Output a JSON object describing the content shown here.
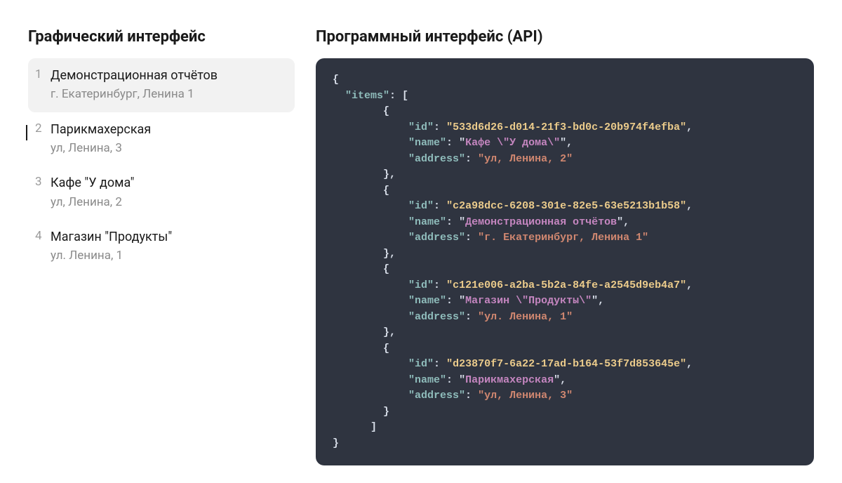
{
  "left": {
    "title": "Графический интерфейс",
    "items": [
      {
        "num": "1",
        "name": "Демонстрационная отчётов",
        "address": "г. Екатеринбург, Ленина 1",
        "selected": true,
        "cursor": false
      },
      {
        "num": "2",
        "name": "Парикмахерская",
        "address": "ул, Ленина, 3",
        "selected": false,
        "cursor": true
      },
      {
        "num": "3",
        "name": "Кафе \"У дома\"",
        "address": "ул, Ленина, 2",
        "selected": false,
        "cursor": false
      },
      {
        "num": "4",
        "name": "Магазин \"Продукты\"",
        "address": "ул. Ленина, 1",
        "selected": false,
        "cursor": false
      }
    ]
  },
  "right": {
    "title": "Программный интерфейс (API)",
    "json_root_key": "items",
    "records": [
      {
        "id": "533d6d26-d014-21f3-bd0c-20b974f4efba",
        "name": "Кафе \\\"У дома\\\"",
        "address": "ул, Ленина, 2"
      },
      {
        "id": "c2a98dcc-6208-301e-82e5-63e5213b1b58",
        "name": "Демонстрационная отчётов",
        "address": "г. Екатеринбург, Ленина 1"
      },
      {
        "id": "c121e006-a2ba-5b2a-84fe-a2545d9eb4a7",
        "name": "Магазин \\\"Продукты\\\"",
        "address": "ул. Ленина, 1"
      },
      {
        "id": "d23870f7-6a22-17ad-b164-53f7d853645e",
        "name": "Парикмахерская",
        "address": "ул, Ленина, 3"
      }
    ],
    "keys": {
      "id": "id",
      "name": "name",
      "address": "address"
    }
  }
}
